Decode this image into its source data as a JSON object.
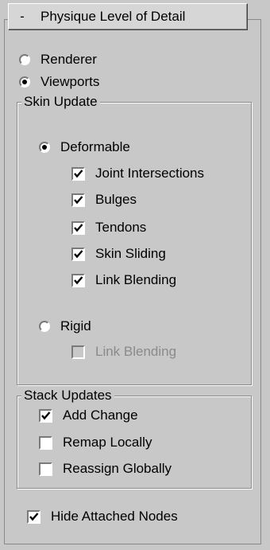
{
  "rollout": {
    "collapse_symbol": "-",
    "title": "Physique Level of Detail"
  },
  "lod": {
    "renderer_label": "Renderer",
    "renderer_selected": false,
    "viewports_label": "Viewports",
    "viewports_selected": true
  },
  "skin_update": {
    "group_label": "Skin Update",
    "deformable_label": "Deformable",
    "deformable_selected": true,
    "options": [
      {
        "label": "Joint Intersections",
        "checked": true
      },
      {
        "label": "Bulges",
        "checked": true
      },
      {
        "label": "Tendons",
        "checked": true
      },
      {
        "label": "Skin Sliding",
        "checked": true
      },
      {
        "label": "Link Blending",
        "checked": true
      }
    ],
    "rigid_label": "Rigid",
    "rigid_selected": false,
    "rigid_link_blending_label": "Link Blending",
    "rigid_link_blending_checked": false,
    "rigid_link_blending_enabled": false
  },
  "stack_updates": {
    "group_label": "Stack Updates",
    "options": [
      {
        "label": "Add Change",
        "checked": true
      },
      {
        "label": "Remap Locally",
        "checked": false
      },
      {
        "label": "Reassign Globally",
        "checked": false
      }
    ]
  },
  "hide_attached_nodes": {
    "label": "Hide Attached Nodes",
    "checked": true
  },
  "colors": {
    "panel_bg": "#c8c8c8",
    "disabled_text": "#8a8a8a",
    "checkmark": "#000000"
  },
  "icons": {
    "checkmark": "checkmark-icon",
    "collapse": "minus-icon"
  }
}
